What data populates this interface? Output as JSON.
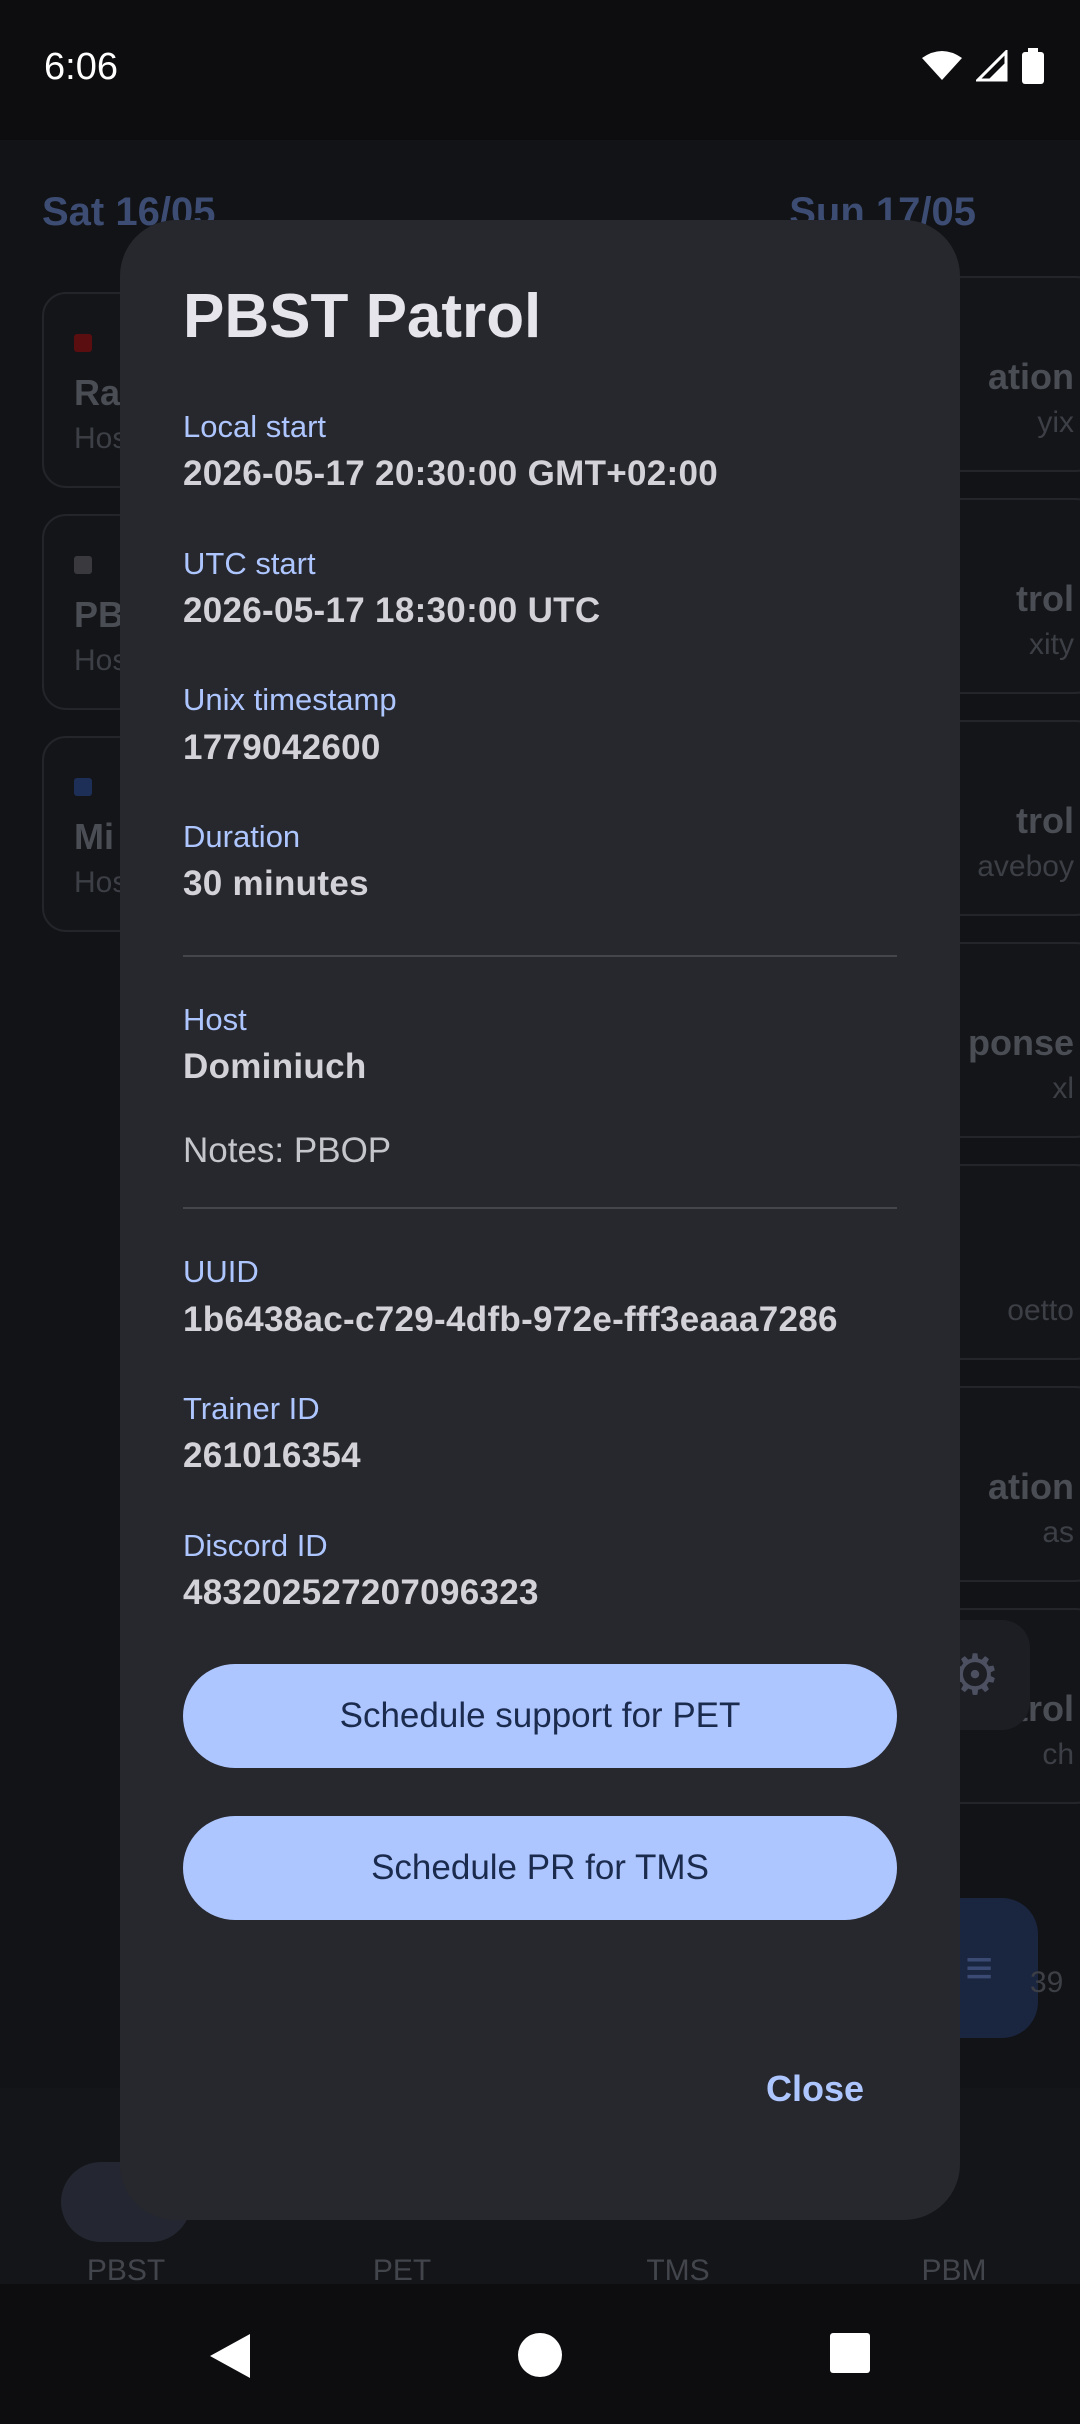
{
  "status_bar": {
    "time": "6:06"
  },
  "background": {
    "day_left": "Sat 16/05",
    "day_right": "Sun 17/05",
    "left_events": [
      {
        "title": "Ra",
        "sub": "Hos",
        "color": "#5a0e10"
      },
      {
        "title": "PB",
        "sub": "Hos",
        "color": "#3a3a3e"
      },
      {
        "title": "Mi",
        "sub": "Hos",
        "color": "#1e2f57"
      }
    ],
    "right_events": [
      {
        "title": "ation",
        "sub": "yix"
      },
      {
        "title": "trol",
        "sub": "xity"
      },
      {
        "title": "trol",
        "sub": "aveboy"
      },
      {
        "title": "ponse",
        "sub": "xl"
      },
      {
        "title": "",
        "sub": "oetto"
      },
      {
        "title": "ation",
        "sub": "as"
      },
      {
        "title": "trol",
        "sub": "ch"
      },
      {
        "title": "",
        "sub": "39"
      }
    ],
    "nav": [
      "PBST",
      "PET",
      "TMS",
      "PBM"
    ]
  },
  "dialog": {
    "title": "PBST Patrol",
    "fields": {
      "local_start": {
        "label": "Local start",
        "value": "2026-05-17 20:30:00 GMT+02:00"
      },
      "utc_start": {
        "label": "UTC start",
        "value": "2026-05-17 18:30:00 UTC"
      },
      "unix": {
        "label": "Unix timestamp",
        "value": "1779042600"
      },
      "duration": {
        "label": "Duration",
        "value": "30 minutes"
      },
      "host": {
        "label": "Host",
        "value": "Dominiuch"
      },
      "uuid": {
        "label": "UUID",
        "value": "1b6438ac-c729-4dfb-972e-fff3eaaa7286"
      },
      "trainer": {
        "label": "Trainer ID",
        "value": "261016354"
      },
      "discord": {
        "label": "Discord ID",
        "value": "483202527207096323"
      }
    },
    "notes": "Notes: PBOP",
    "buttons": {
      "support_pet": "Schedule support for PET",
      "pr_tms": "Schedule PR for TMS",
      "close": "Close"
    }
  },
  "colors": {
    "accent": "#aec6ff",
    "dialog_bg": "#27282d"
  }
}
